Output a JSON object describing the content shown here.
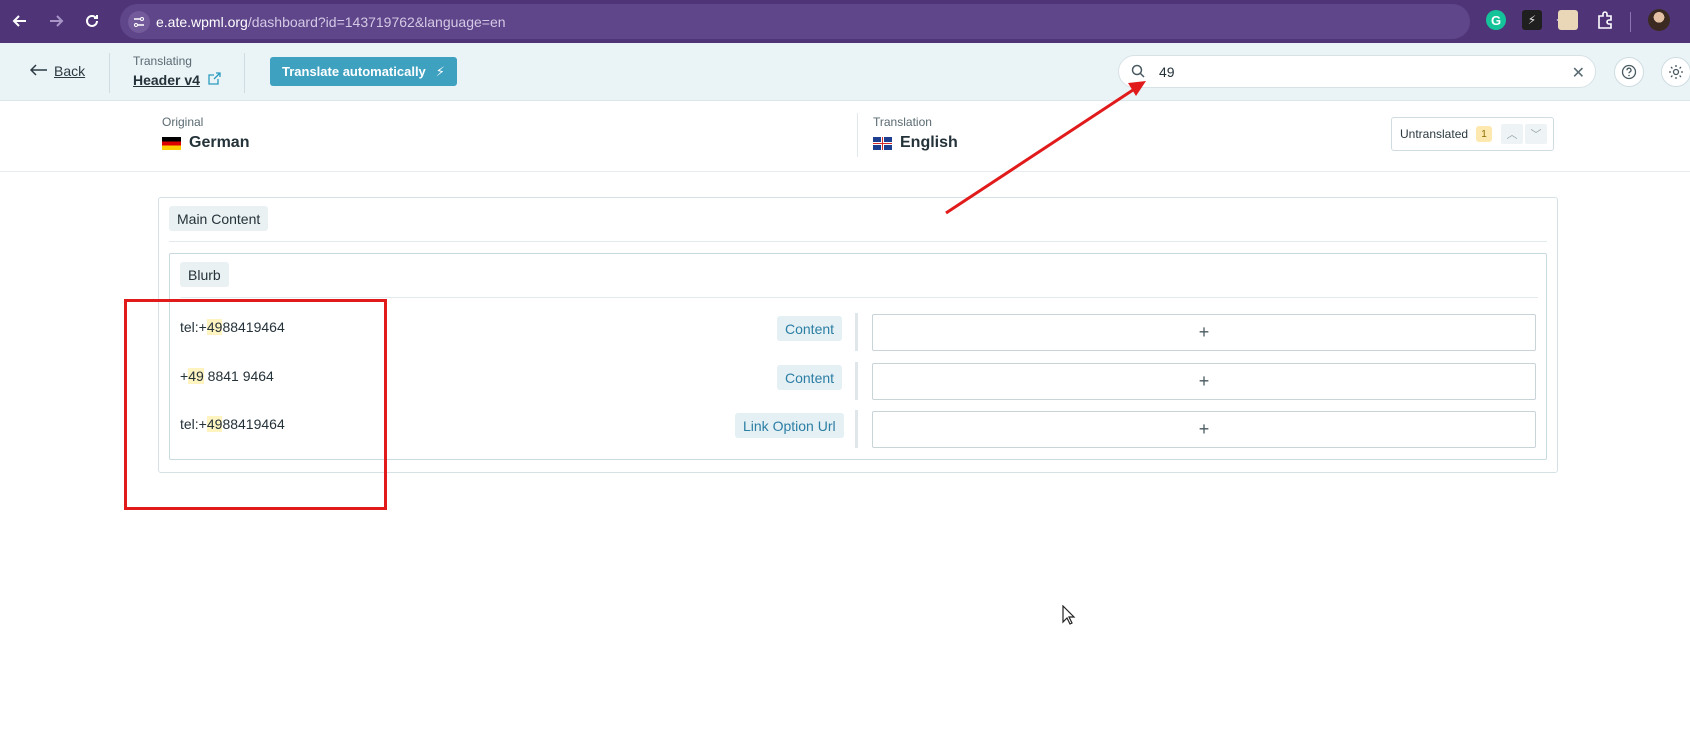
{
  "browser": {
    "url_host": "e.ate.wpml.org",
    "url_path": "/dashboard?id=143719762&language=en",
    "extensions": [
      "grammarly-icon",
      "bolt-extension-icon",
      "card-extension-icon",
      "puzzle-icon"
    ]
  },
  "toolbar": {
    "back_label": "Back",
    "translating_label": "Translating",
    "document_name": "Header v4",
    "translate_auto_label": "Translate automatically",
    "search_value": "49",
    "search_placeholder": "Search"
  },
  "languages": {
    "original_label": "Original",
    "original_lang": "German",
    "translation_label": "Translation",
    "translation_lang": "English"
  },
  "filter": {
    "label": "Untranslated",
    "count": "1"
  },
  "content": {
    "section_label": "Main Content",
    "block_label": "Blurb",
    "rows": [
      {
        "pre": "tel:+",
        "match": "49",
        "post": "88419464",
        "field": "Content",
        "add": "+"
      },
      {
        "pre": "+",
        "match": "49",
        "post": " 8841 9464",
        "field": "Content",
        "add": "+"
      },
      {
        "pre": "tel:+",
        "match": "49",
        "post": "88419464",
        "field": "Link Option Url",
        "add": "+"
      }
    ]
  },
  "colors": {
    "browser_bar": "#4f3578",
    "accent": "#3fa1c0",
    "highlight": "#fff3bf",
    "annotation": "#e11b1b"
  }
}
